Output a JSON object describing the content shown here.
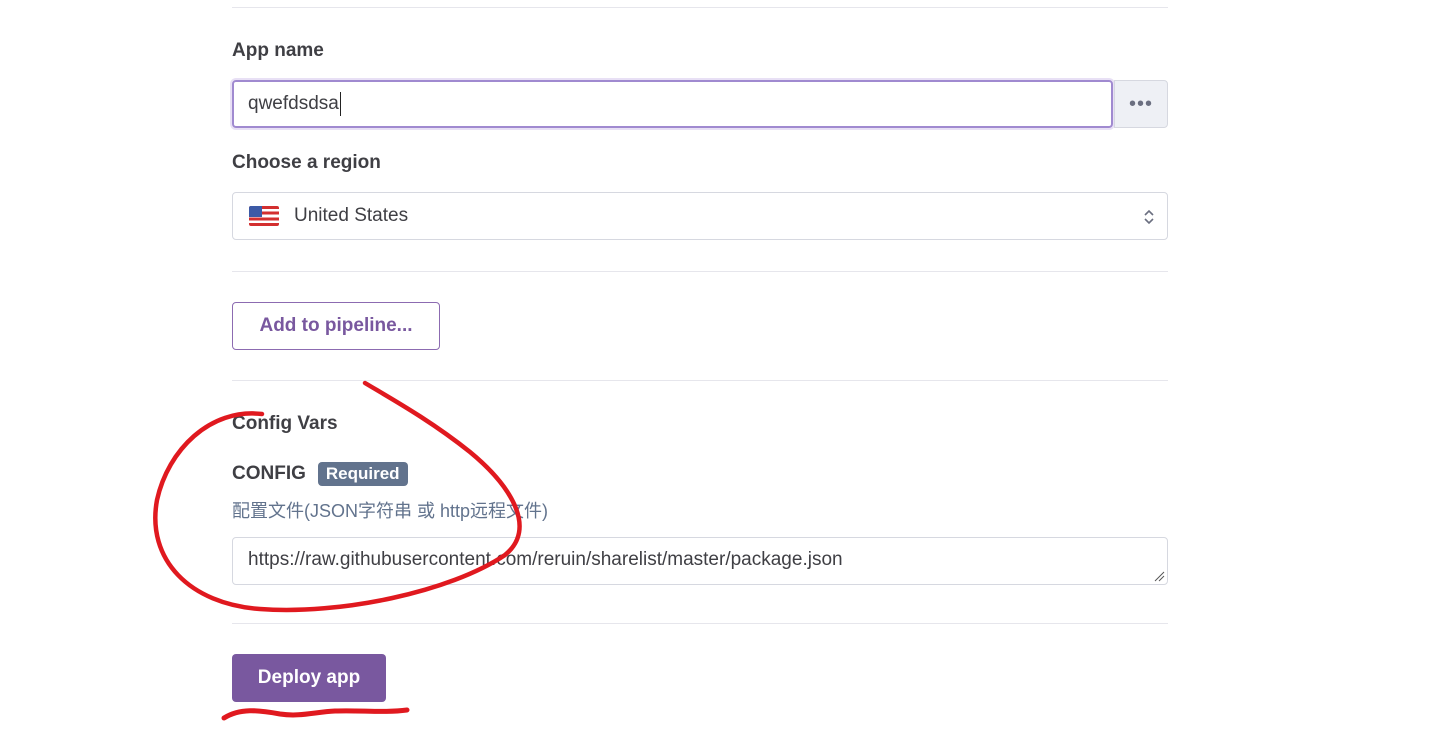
{
  "app_name": {
    "label": "App name",
    "value": "qwefdsdsa",
    "more_icon": "more-horizontal-icon"
  },
  "region": {
    "label": "Choose a region",
    "selected": "United States",
    "flag_icon": "us-flag-icon",
    "chevron_icon": "chevron-up-down-icon"
  },
  "pipeline": {
    "button_label": "Add to pipeline..."
  },
  "config_vars": {
    "heading": "Config Vars",
    "key": "CONFIG",
    "badge": "Required",
    "description": "配置文件(JSON字符串 或 http远程文件)",
    "value": "https://raw.githubusercontent.com/reruin/sharelist/master/package.json"
  },
  "deploy": {
    "button_label": "Deploy app"
  },
  "colors": {
    "accent": "#79589f",
    "badge": "#62738d",
    "annotation": "#e0191f"
  }
}
